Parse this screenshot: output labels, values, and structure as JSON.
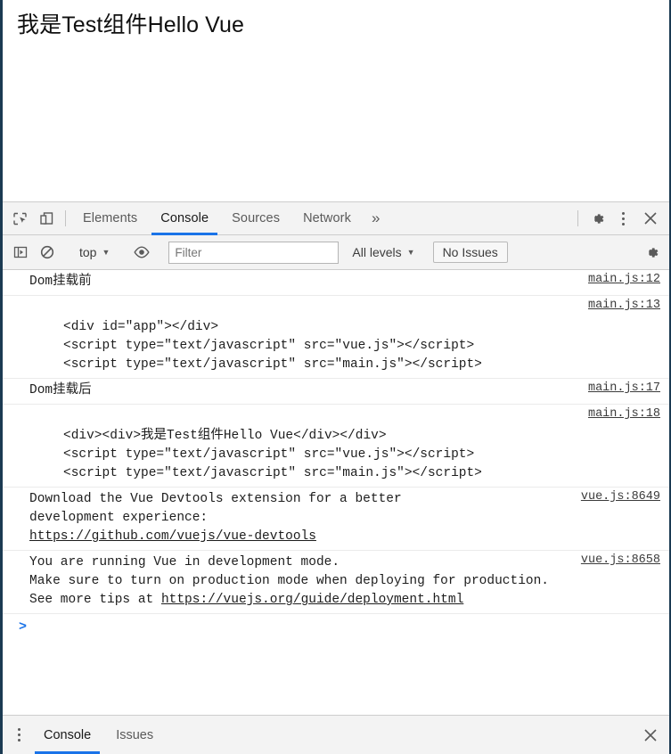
{
  "page": {
    "heading": "我是Test组件Hello Vue"
  },
  "devtools": {
    "inspect_icon": "inspect-element-icon",
    "device_icon": "device-toolbar-icon",
    "tabs": [
      {
        "label": "Elements",
        "active": false
      },
      {
        "label": "Console",
        "active": true
      },
      {
        "label": "Sources",
        "active": false
      },
      {
        "label": "Network",
        "active": false
      }
    ],
    "more_tabs_label": "»",
    "settings_icon": "gear-icon",
    "kebab_icon": "more-options-icon",
    "close_icon": "close-icon"
  },
  "console_toolbar": {
    "sidebar_icon": "console-sidebar-icon",
    "clear_icon": "clear-console-icon",
    "context_label": "top",
    "eye_icon": "live-expression-eye-icon",
    "filter_placeholder": "Filter",
    "filter_value": "",
    "levels_label": "All levels",
    "issues_label": "No Issues",
    "settings_icon": "gear-icon"
  },
  "messages": [
    {
      "kind": "text-with-anchor",
      "text": "Dom挂载前",
      "anchor": "main.js:12"
    },
    {
      "kind": "blank-header-block",
      "anchor": "main.js:13",
      "lines": [
        "<div id=\"app\"></div>",
        "<script type=\"text/javascript\" src=\"vue.js\"></script>",
        "<script type=\"text/javascript\" src=\"main.js\"></script>"
      ]
    },
    {
      "kind": "text-with-anchor",
      "text": "Dom挂载后",
      "anchor": "main.js:17"
    },
    {
      "kind": "blank-header-block",
      "anchor": "main.js:18",
      "lines": [
        "<div><div>我是Test组件Hello Vue</div></div>",
        "<script type=\"text/javascript\" src=\"vue.js\"></script>",
        "<script type=\"text/javascript\" src=\"main.js\"></script>"
      ]
    },
    {
      "kind": "wrapped",
      "anchor": "vue.js:8649",
      "line1": "Download the Vue Devtools extension for a better",
      "line2": "development experience:",
      "link": "https://github.com/vuejs/vue-devtools"
    },
    {
      "kind": "wrapped2",
      "anchor": "vue.js:8658",
      "line1": "You are running Vue in development mode.",
      "line2": "Make sure to turn on production mode when deploying for production.",
      "line3_prefix": "See more tips at ",
      "link": "https://vuejs.org/guide/deployment.html"
    }
  ],
  "prompt": {
    "caret": ">",
    "value": "",
    "placeholder": ""
  },
  "drawer": {
    "tabs": [
      {
        "label": "Console",
        "active": true
      },
      {
        "label": "Issues",
        "active": false
      }
    ]
  },
  "colors": {
    "accent": "#1a73e8",
    "toolbar_bg": "#f3f3f3",
    "border": "#cdcdcd",
    "window_stripe": "#1b3a52",
    "text": "#1d1d1d"
  }
}
